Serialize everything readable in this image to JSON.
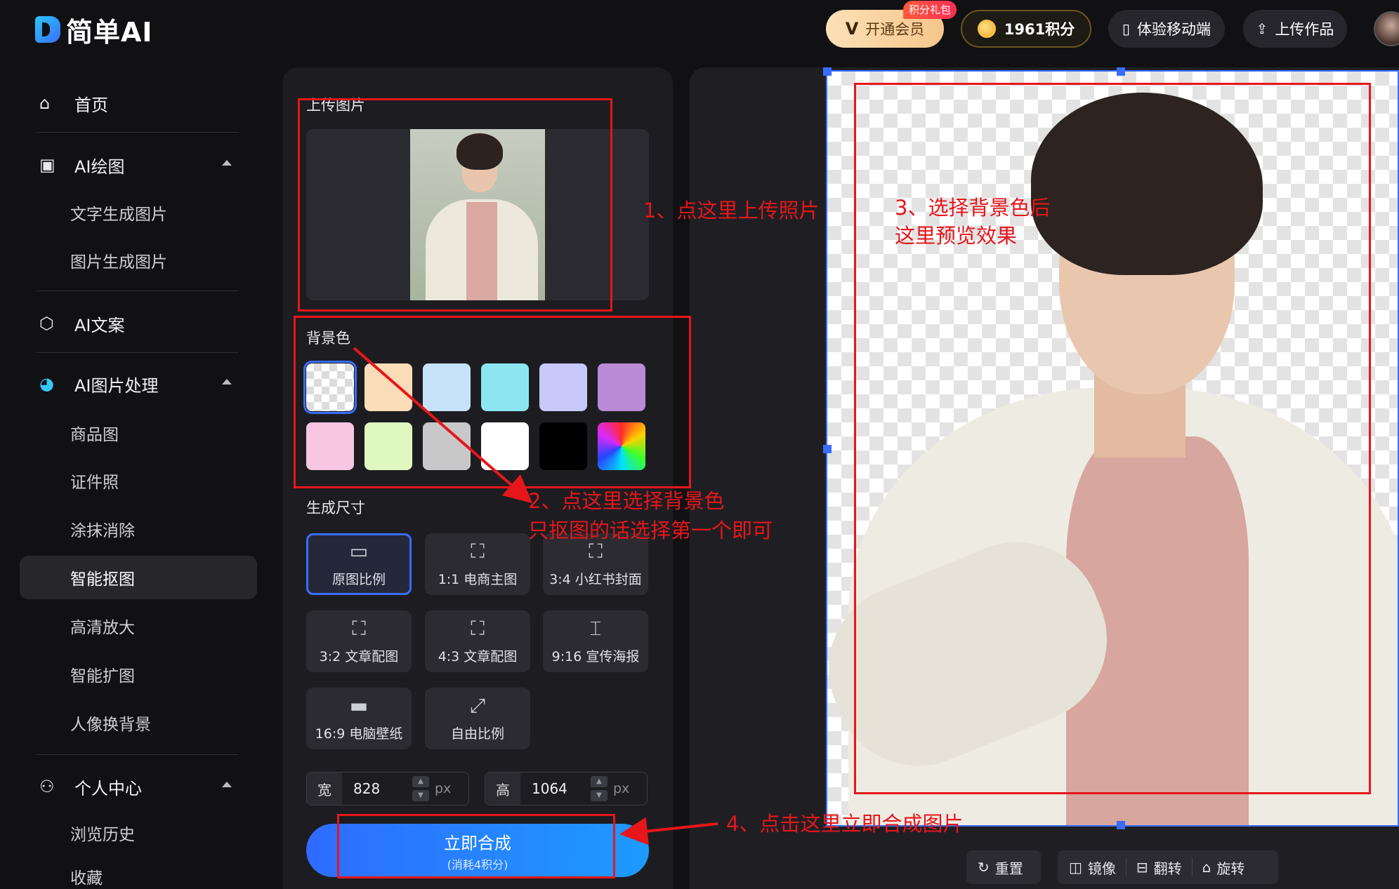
{
  "header": {
    "logo_text": "简单AI",
    "vip_label": "开通会员",
    "vip_mark": "V",
    "vip_badge": "积分礼包",
    "points_label": "1961积分",
    "mobile_label": "体验移动端",
    "upload_label": "上传作品"
  },
  "sidebar": {
    "home": "首页",
    "ai_draw": "AI绘图",
    "ai_draw_items": [
      "文字生成图片",
      "图片生成图片"
    ],
    "ai_copy": "AI文案",
    "ai_image": "AI图片处理",
    "ai_image_items": [
      "商品图",
      "证件照",
      "涂抹消除",
      "智能抠图",
      "高清放大",
      "智能扩图",
      "人像换背景"
    ],
    "active_item": "智能抠图",
    "personal": "个人中心",
    "personal_items": [
      "浏览历史",
      "收藏"
    ]
  },
  "panel": {
    "upload_title": "上传图片",
    "bg_title": "背景色",
    "bg_colors": [
      "transparent",
      "#fbdcb8",
      "#c6e2f8",
      "#8ce6f2",
      "#c8c8fa",
      "#b98ad6",
      "#f7c6e2",
      "#def8c0",
      "#c8c8c8",
      "#ffffff",
      "#000000",
      "rainbow"
    ],
    "size_title": "生成尺寸",
    "ratios": [
      {
        "label": "原图比例",
        "icon": "image-icon"
      },
      {
        "label": "1:1 电商主图",
        "icon": "square-frame-icon"
      },
      {
        "label": "3:4 小红书封面",
        "icon": "portrait-frame-icon"
      },
      {
        "label": "3:2 文章配图",
        "icon": "landscape-frame-icon"
      },
      {
        "label": "4:3 文章配图",
        "icon": "landscape-frame-icon"
      },
      {
        "label": "9:16 宣传海报",
        "icon": "tall-frame-icon"
      },
      {
        "label": "16:9 电脑壁纸",
        "icon": "wide-frame-icon"
      },
      {
        "label": "自由比例",
        "icon": "free-resize-icon"
      }
    ],
    "width_label": "宽",
    "width_value": "828",
    "height_label": "高",
    "height_value": "1064",
    "unit": "px",
    "compose_label": "立即合成",
    "compose_cost": "(消耗4积分)"
  },
  "toolbar": {
    "reset": "重置",
    "mirror": "镜像",
    "flip": "翻转",
    "rotate": "旋转"
  },
  "annotations": {
    "step1": "1、点这里上传照片",
    "step2_line1": "2、点这里选择背景色",
    "step2_line2": "只抠图的话选择第一个即可",
    "step3_line1": "3、选择背景色后",
    "step3_line2": "这里预览效果",
    "step4": "4、点击这里立即合成图片",
    "color": "#e6161b"
  }
}
